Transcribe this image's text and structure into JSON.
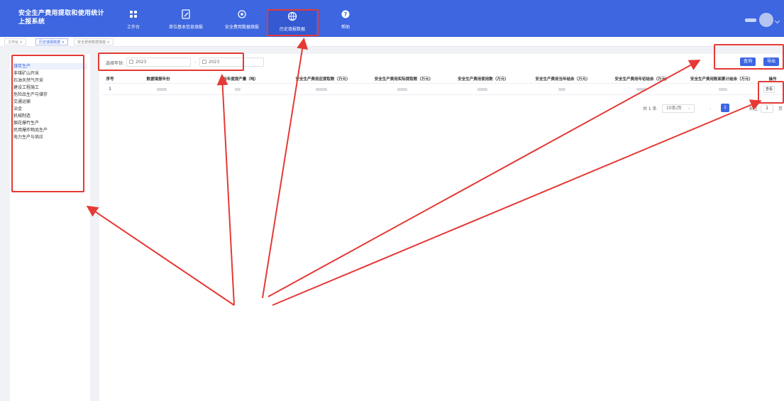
{
  "header": {
    "title_line1": "安全生产费用提取和使用统计",
    "title_line2": "上报系统",
    "nav": [
      {
        "label": "工作台",
        "icon": "grid-icon"
      },
      {
        "label": "单位基本信息填报",
        "icon": "edit-icon"
      },
      {
        "label": "安全费用数据填报",
        "icon": "target-icon"
      },
      {
        "label": "历史填报数据",
        "icon": "globe-icon"
      },
      {
        "label": "帮助",
        "icon": "help-icon"
      }
    ]
  },
  "tags": [
    "工作台 ×",
    "历史填报数据 ×",
    "安全费用数据填报 ×"
  ],
  "sidebar": {
    "items": [
      "煤炭生产",
      "非煤矿山开采",
      "石油天然气开采",
      "建设工程施工",
      "危险品生产与储存",
      "交通运输",
      "冶金",
      "机械制造",
      "烟花爆竹生产",
      "民用爆炸物品生产",
      "电力生产与供应"
    ]
  },
  "filter": {
    "label": "选择年份:",
    "start_year": "2023",
    "separator": "-",
    "end_year": "2023"
  },
  "buttons": {
    "query": "查询",
    "export": "导出"
  },
  "table": {
    "headers": [
      "序号",
      "数据填报年份",
      "当年度提产量（吨）",
      "安全生产费用应提取数（万元）",
      "安全生产费用实际提取数（万元）",
      "安全生产费用使用数（万元）",
      "安全生产费用当年结余（万元）",
      "安全生产费用年初结余（万元）",
      "安全生产费用账面累计结余（万元）",
      "操作"
    ],
    "rows": [
      {
        "index": "1",
        "action": "查看"
      }
    ]
  },
  "pagination": {
    "total": "共 1 条",
    "page_size": "10条/页",
    "current_page": "1",
    "goto_label": "前往",
    "goto_value": "1",
    "page_suffix": "页"
  },
  "colors": {
    "primary": "#3d66e0",
    "annotation": "#e53935"
  }
}
